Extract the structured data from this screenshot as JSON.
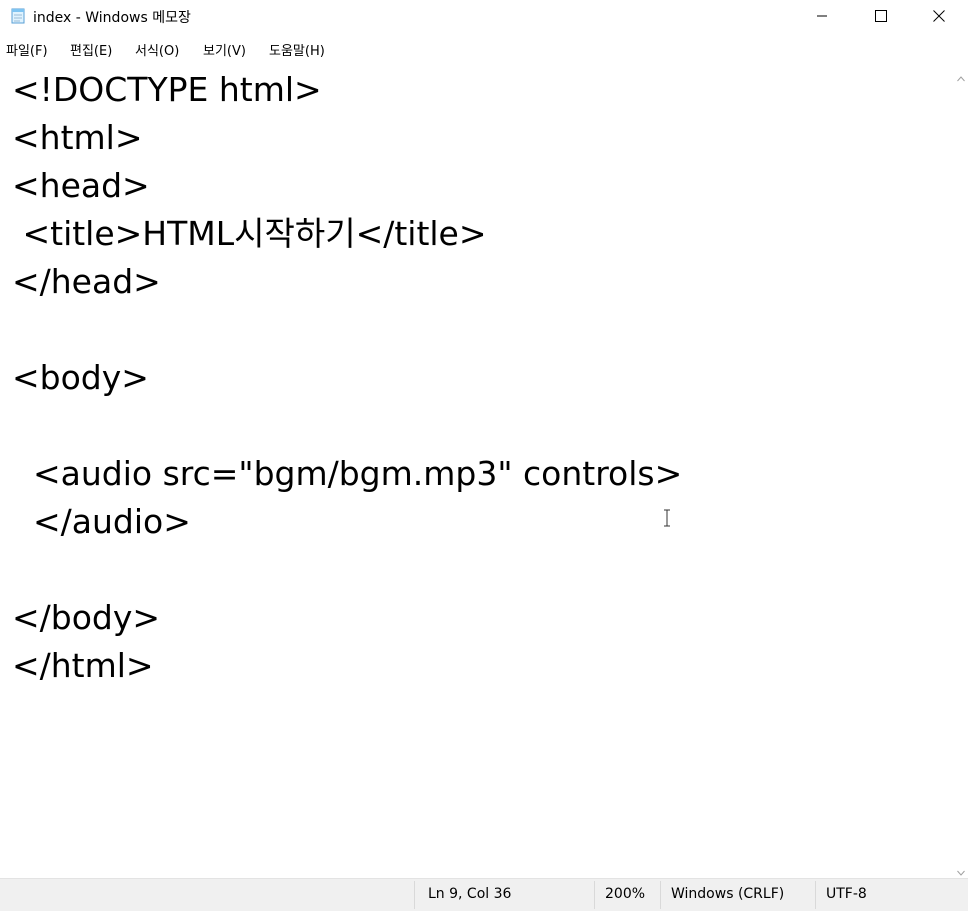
{
  "window": {
    "title": "index - Windows 메모장",
    "app_icon": "notepad-icon",
    "controls": [
      "minimize-icon",
      "maximize-icon",
      "close-icon"
    ]
  },
  "menu": {
    "items": [
      {
        "label": "파일(F)"
      },
      {
        "label": "편집(E)"
      },
      {
        "label": "서식(O)"
      },
      {
        "label": "보기(V)"
      },
      {
        "label": "도움말(H)"
      }
    ]
  },
  "editor": {
    "lines": [
      "<!DOCTYPE html>",
      "<html>",
      "<head>",
      " <title>HTML시작하기</title>",
      "</head>",
      "",
      "<body>",
      "",
      "  <audio src=\"bgm/bgm.mp3\" controls>",
      "  </audio>",
      "",
      "</body>",
      "</html>"
    ]
  },
  "status": {
    "position": "Ln 9, Col 36",
    "zoom": "200%",
    "line_ending": "Windows (CRLF)",
    "encoding": "UTF-8"
  }
}
